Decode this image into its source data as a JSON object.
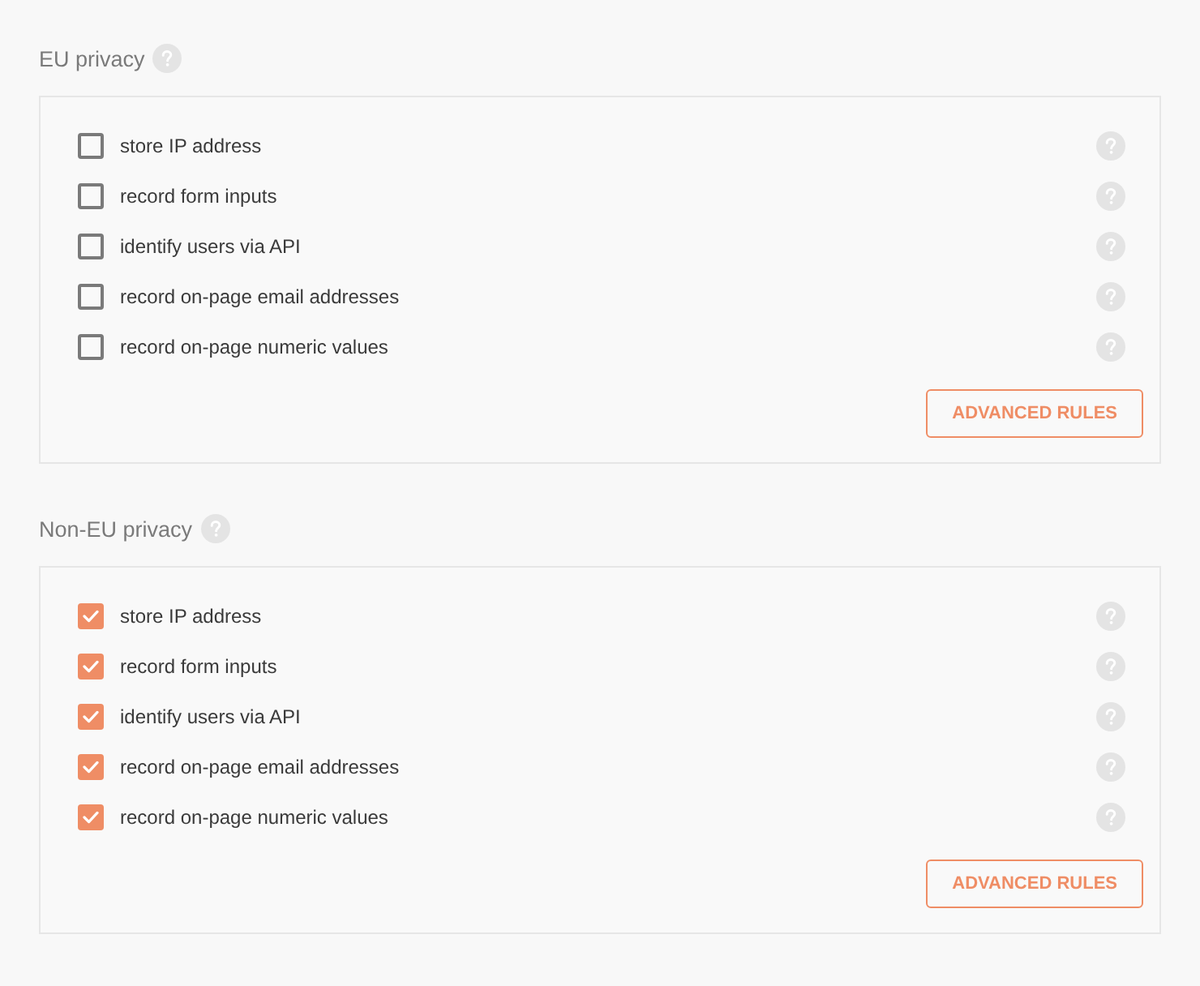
{
  "sections": [
    {
      "title": "EU privacy",
      "options": [
        {
          "label": "store IP address",
          "checked": false
        },
        {
          "label": "record form inputs",
          "checked": false
        },
        {
          "label": "identify users via API",
          "checked": false
        },
        {
          "label": "record on-page email addresses",
          "checked": false
        },
        {
          "label": "record on-page numeric values",
          "checked": false
        }
      ],
      "button": "ADVANCED RULES"
    },
    {
      "title": "Non-EU privacy",
      "options": [
        {
          "label": "store IP address",
          "checked": true
        },
        {
          "label": "record form inputs",
          "checked": true
        },
        {
          "label": "identify users via API",
          "checked": true
        },
        {
          "label": "record on-page email addresses",
          "checked": true
        },
        {
          "label": "record on-page numeric values",
          "checked": true
        }
      ],
      "button": "ADVANCED RULES"
    }
  ]
}
